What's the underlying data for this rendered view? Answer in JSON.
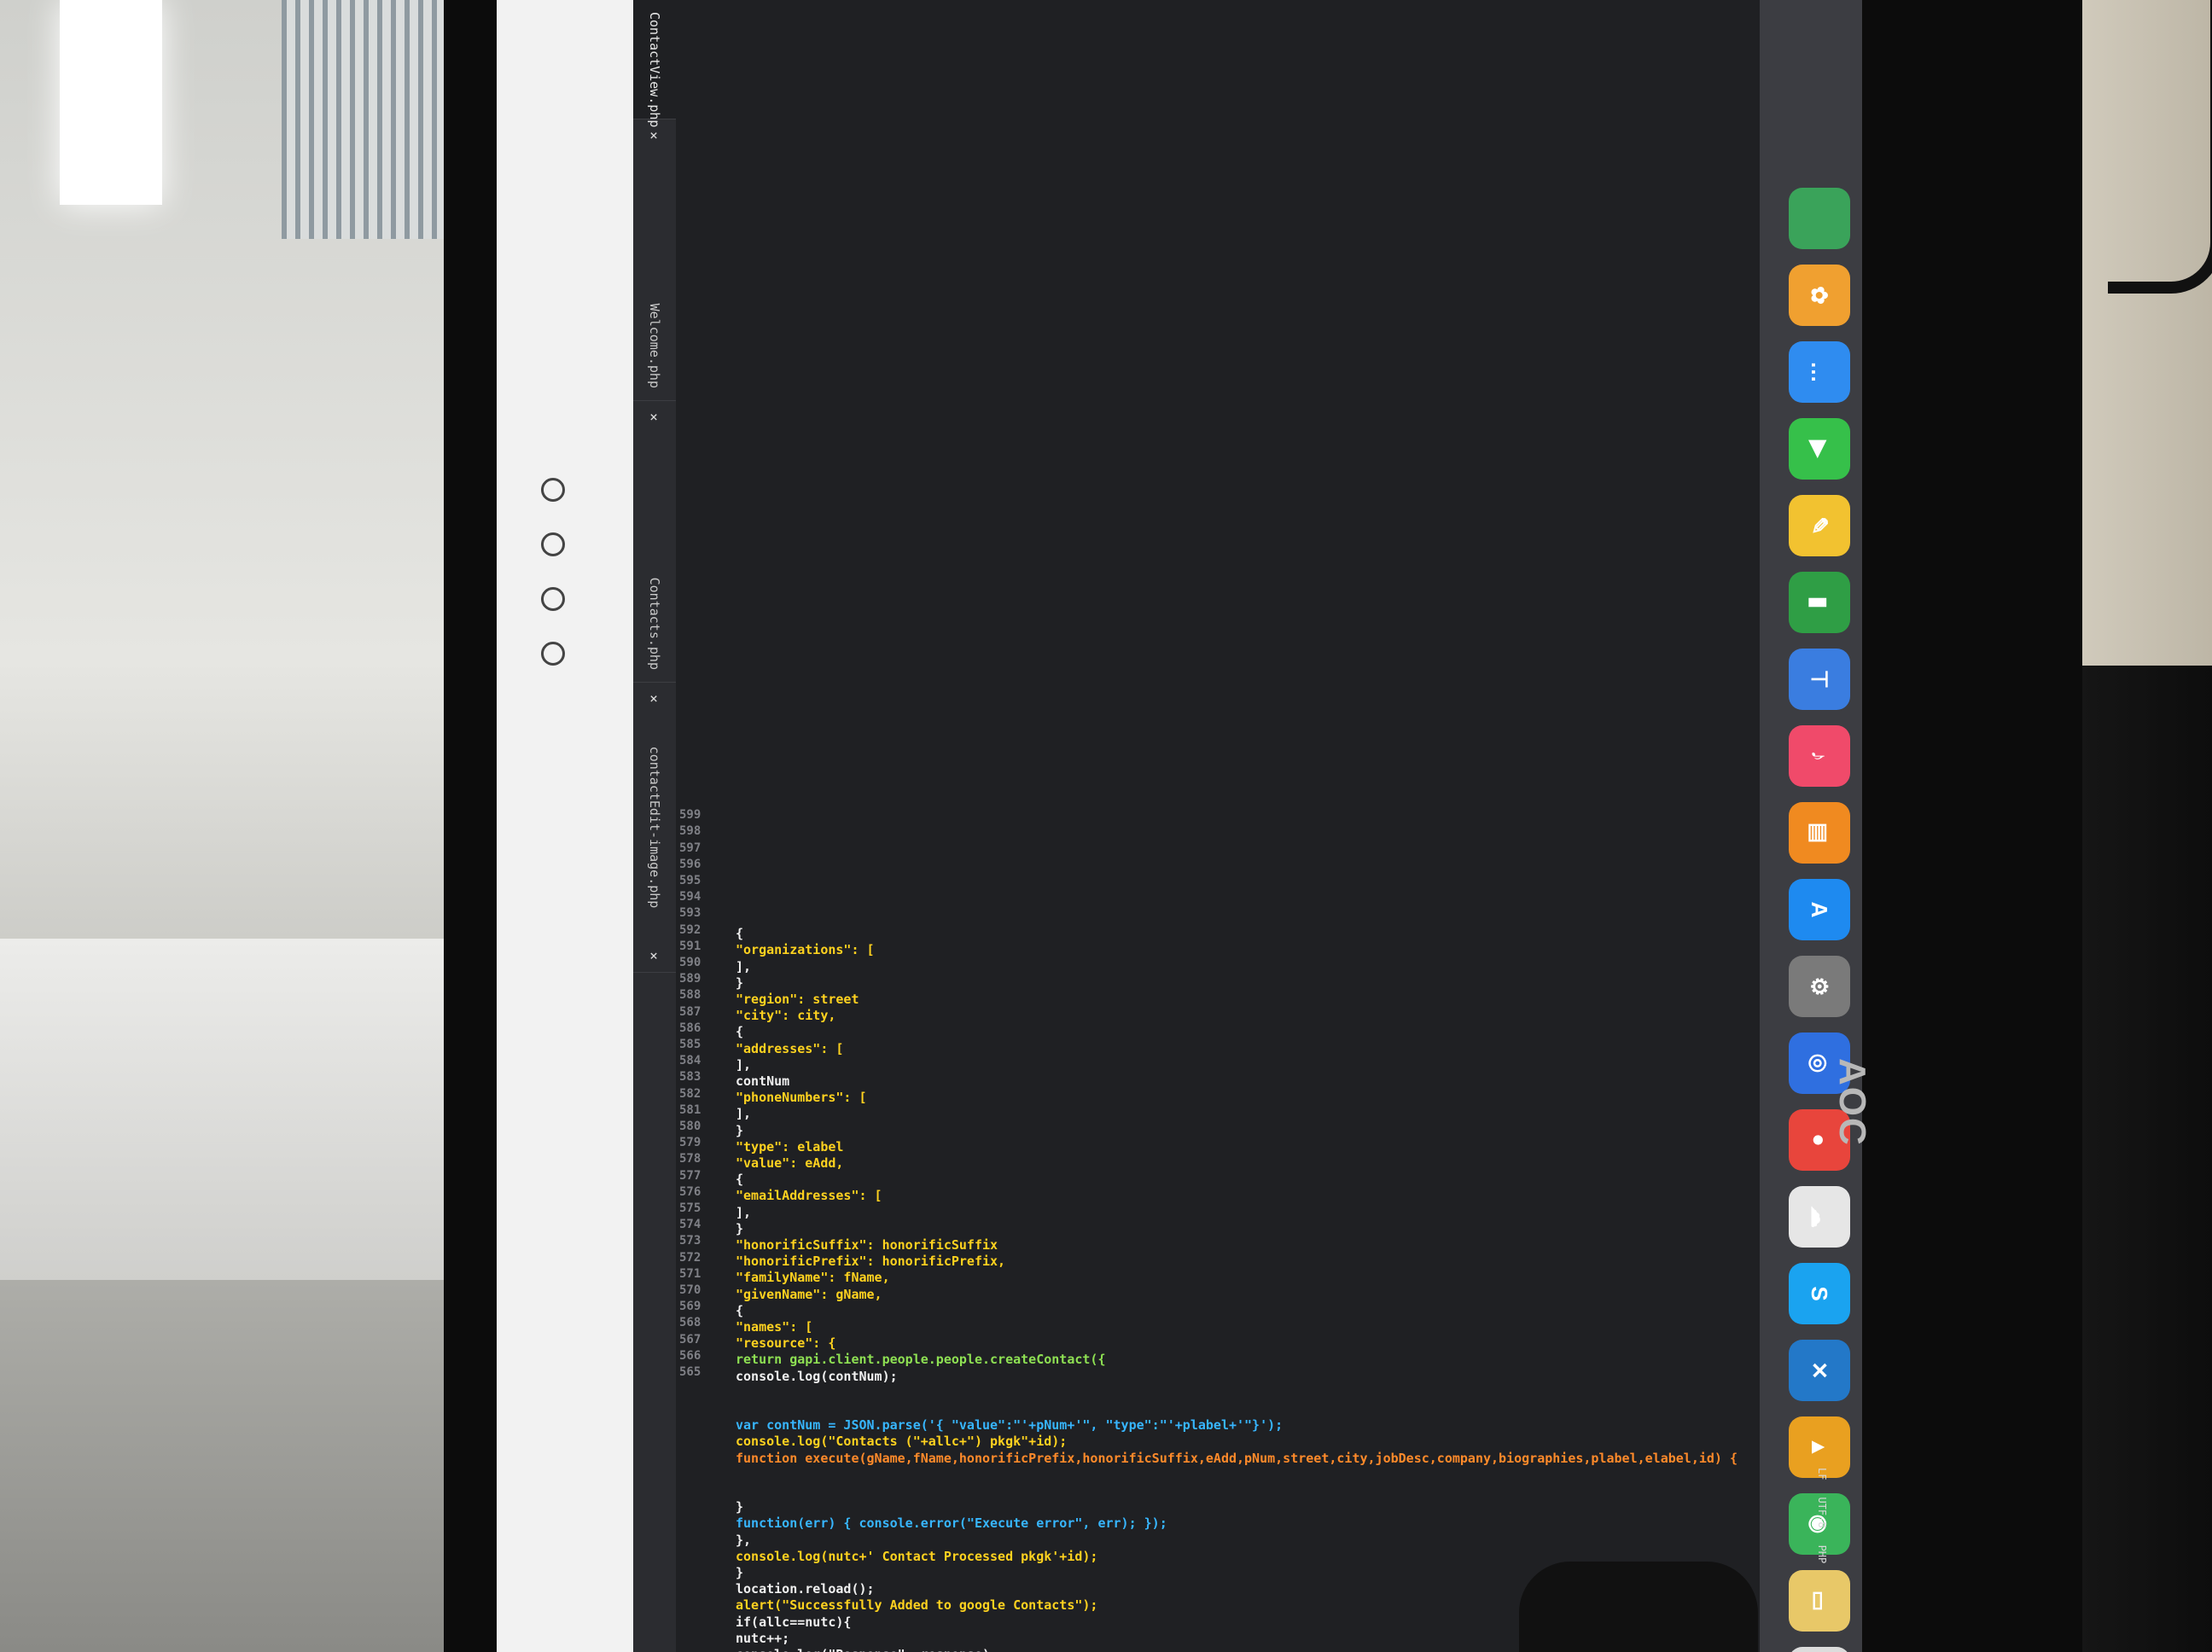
{
  "monitor": {
    "brand": "AOC"
  },
  "browser": {
    "tabs": [
      {
        "label": "ContactView.php",
        "close": "×",
        "active": true
      },
      {
        "label": "Welcome.php",
        "close": "×"
      },
      {
        "label": "Contacts.php",
        "close": "×"
      },
      {
        "label": "contactEdit-image.php",
        "close": "×"
      }
    ]
  },
  "editor": {
    "line_numbers": [
      "565",
      "566",
      "567",
      "568",
      "569",
      "570",
      "571",
      "572",
      "573",
      "574",
      "575",
      "576",
      "577",
      "578",
      "579",
      "580",
      "581",
      "582",
      "583",
      "584",
      "585",
      "586",
      "587",
      "588",
      "589",
      "590",
      "591",
      "592",
      "593",
      "594",
      "595",
      "596",
      "597",
      "598",
      "599"
    ],
    "lines": [
      {
        "text": "console.log(\"Response\", response);",
        "cls": "tok-plain"
      },
      {
        "text": "nutc++;",
        "cls": "tok-plain"
      },
      {
        "text": "if(allc==nutc){",
        "cls": "tok-plain"
      },
      {
        "text": "alert(\"Successfully Added to google Contacts\");",
        "cls": "tok-str"
      },
      {
        "text": "location.reload();",
        "cls": "tok-plain"
      },
      {
        "text": "}",
        "cls": "tok-plain"
      },
      {
        "text": "console.log(nutc+' Contact Processed pkgk'+id);",
        "cls": "tok-str"
      },
      {
        "text": "},",
        "cls": "tok-plain"
      },
      {
        "text": "function(err) { console.error(\"Execute error\", err); });",
        "cls": "tok-kw"
      },
      {
        "text": "}",
        "cls": "tok-plain"
      },
      {
        "text": "",
        "cls": "tok-plain"
      },
      {
        "text": "",
        "cls": "tok-plain"
      },
      {
        "text": "function execute(gName,fName,honorificPrefix,honorificSuffix,eAdd,pNum,street,city,jobDesc,company,biographies,plabel,elabel,id) {",
        "cls": "tok-var"
      },
      {
        "text": "console.log(\"Contacts (\"+allc+\") pkgk\"+id);",
        "cls": "tok-str"
      },
      {
        "text": "var contNum = JSON.parse('{ \"value\":\"'+pNum+'\", \"type\":\"'+plabel+'\"}');",
        "cls": "tok-kw"
      },
      {
        "text": "",
        "cls": "tok-plain"
      },
      {
        "text": "",
        "cls": "tok-plain"
      },
      {
        "text": "console.log(contNum);",
        "cls": "tok-plain"
      },
      {
        "text": "return gapi.client.people.people.createContact({",
        "cls": "tok-fn"
      },
      {
        "text": "\"resource\": {",
        "cls": "tok-str"
      },
      {
        "text": "\"names\": [",
        "cls": "tok-str"
      },
      {
        "text": "{",
        "cls": "tok-plain"
      },
      {
        "text": "\"givenName\": gName,",
        "cls": "tok-str"
      },
      {
        "text": "\"familyName\": fName,",
        "cls": "tok-str"
      },
      {
        "text": "\"honorificPrefix\": honorificPrefix,",
        "cls": "tok-str"
      },
      {
        "text": "\"honorificSuffix\": honorificSuffix",
        "cls": "tok-str"
      },
      {
        "text": "}",
        "cls": "tok-plain"
      },
      {
        "text": "],",
        "cls": "tok-plain"
      },
      {
        "text": "\"emailAddresses\": [",
        "cls": "tok-str"
      },
      {
        "text": "{",
        "cls": "tok-plain"
      },
      {
        "text": "\"value\": eAdd,",
        "cls": "tok-str"
      },
      {
        "text": "\"type\": elabel",
        "cls": "tok-str"
      },
      {
        "text": "}",
        "cls": "tok-plain"
      },
      {
        "text": "],",
        "cls": "tok-plain"
      },
      {
        "text": "\"phoneNumbers\": [",
        "cls": "tok-str"
      },
      {
        "text": "contNum",
        "cls": "tok-plain"
      },
      {
        "text": "],",
        "cls": "tok-plain"
      },
      {
        "text": "\"addresses\": [",
        "cls": "tok-str"
      },
      {
        "text": "{",
        "cls": "tok-plain"
      },
      {
        "text": "\"city\": city,",
        "cls": "tok-str"
      },
      {
        "text": "\"region\": street",
        "cls": "tok-str"
      },
      {
        "text": "}",
        "cls": "tok-plain"
      },
      {
        "text": "],",
        "cls": "tok-plain"
      },
      {
        "text": "\"organizations\": [",
        "cls": "tok-str"
      },
      {
        "text": "{",
        "cls": "tok-plain"
      }
    ]
  },
  "statusbar": {
    "items": [
      "LF",
      "UTF-8",
      "PHP"
    ]
  },
  "dock": {
    "icons": [
      {
        "name": "maps-icon",
        "color": "#3aa35a",
        "glyph": ""
      },
      {
        "name": "photos-icon",
        "color": "#f0a030",
        "glyph": "✿"
      },
      {
        "name": "messages-icon",
        "color": "#2f8cf0",
        "glyph": "…"
      },
      {
        "name": "facetime-icon",
        "color": "#36c04a",
        "glyph": "▶"
      },
      {
        "name": "notes-icon",
        "color": "#f2c230",
        "glyph": "✎"
      },
      {
        "name": "numbers-icon",
        "color": "#2f9e45",
        "glyph": "▮"
      },
      {
        "name": "keynote-icon",
        "color": "#3a7de0",
        "glyph": "⊤"
      },
      {
        "name": "music-icon",
        "color": "#f04a6a",
        "glyph": "♪"
      },
      {
        "name": "books-icon",
        "color": "#f08a20",
        "glyph": "▤"
      },
      {
        "name": "app-store-icon",
        "color": "#1e8af0",
        "glyph": "A"
      },
      {
        "name": "system-preferences-icon",
        "color": "#7a7a7a",
        "glyph": "⚙"
      },
      {
        "name": "zoom-icon",
        "color": "#2f6fe0",
        "glyph": "◎"
      },
      {
        "name": "chrome-icon",
        "color": "#e8453c",
        "glyph": "●"
      },
      {
        "name": "tableplus-icon",
        "color": "#e6e6e6",
        "glyph": "☁"
      },
      {
        "name": "skype-icon",
        "color": "#1aa3f0",
        "glyph": "S"
      },
      {
        "name": "vscode-icon",
        "color": "#2378c8",
        "glyph": "✕"
      },
      {
        "name": "vlc-icon",
        "color": "#e9a020",
        "glyph": "▲"
      },
      {
        "name": "android-studio-icon",
        "color": "#3ab45a",
        "glyph": "◉"
      },
      {
        "name": "folder-icon",
        "color": "#e8c868",
        "glyph": "▭"
      },
      {
        "name": "trash-icon",
        "color": "#dcdcdc",
        "glyph": "▯"
      }
    ]
  }
}
